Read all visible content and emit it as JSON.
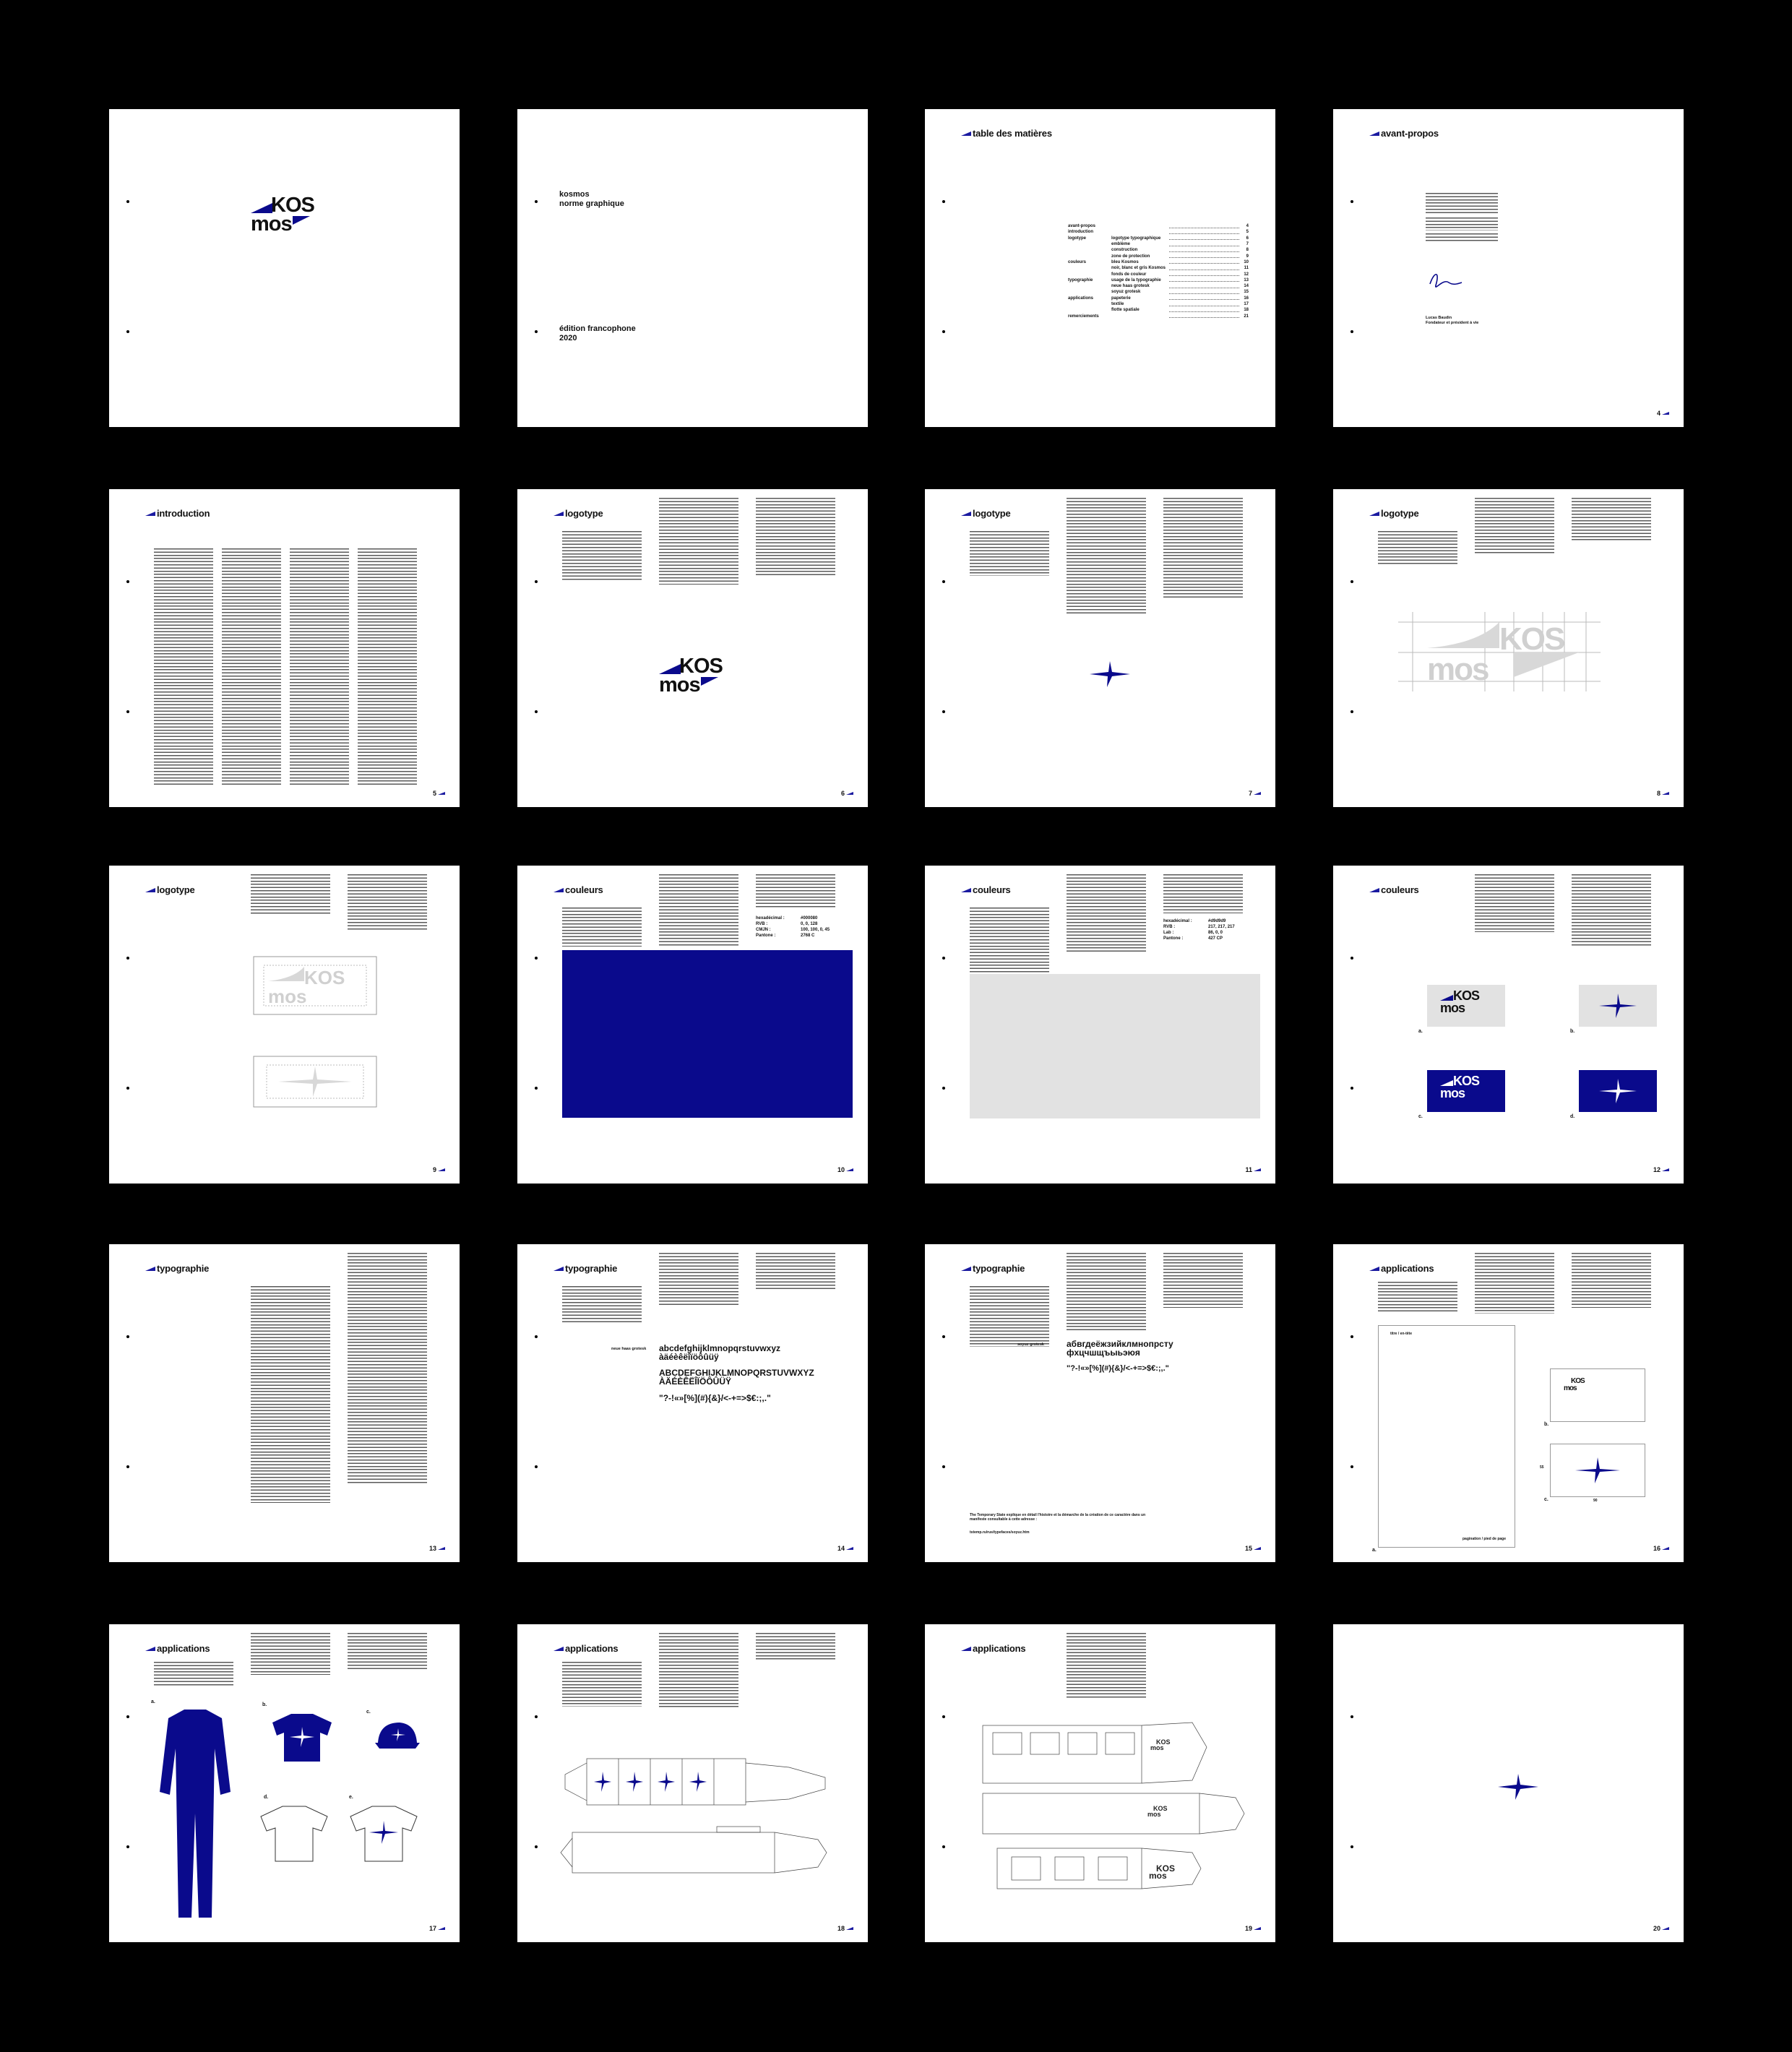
{
  "colors": {
    "brand_blue": "#0a0a8c",
    "accent": "#1a1aa0",
    "light_gray": "#e2e2e2"
  },
  "cover": {
    "logo_top": "KOS",
    "logo_bottom": "mos"
  },
  "title_page": {
    "line1": "kosmos",
    "line2": "norme graphique",
    "edition_line1": "édition francophone",
    "edition_line2": "2020"
  },
  "toc": {
    "title": "table des matières",
    "rows": [
      {
        "section": "avant-propos",
        "item": "",
        "page": "4"
      },
      {
        "section": "introduction",
        "item": "",
        "page": "5"
      },
      {
        "section": "logotype",
        "item": "logotype typographique",
        "page": "6"
      },
      {
        "section": "",
        "item": "emblème",
        "page": "7"
      },
      {
        "section": "",
        "item": "construction",
        "page": "8"
      },
      {
        "section": "",
        "item": "zone de protection",
        "page": "9"
      },
      {
        "section": "couleurs",
        "item": "bleu Kosmos",
        "page": "10"
      },
      {
        "section": "",
        "item": "noir, blanc et gris Kosmos",
        "page": "11"
      },
      {
        "section": "",
        "item": "fonds de couleur",
        "page": "12"
      },
      {
        "section": "typographie",
        "item": "usage de la typographie",
        "page": "13"
      },
      {
        "section": "",
        "item": "neue haas grotesk",
        "page": "14"
      },
      {
        "section": "",
        "item": "soyuz grotesk",
        "page": "15"
      },
      {
        "section": "applications",
        "item": "papeterie",
        "page": "16"
      },
      {
        "section": "",
        "item": "textile",
        "page": "17"
      },
      {
        "section": "",
        "item": "flotte spatiale",
        "page": "18"
      },
      {
        "section": "remerciements",
        "item": "",
        "page": "21"
      }
    ]
  },
  "avant_propos": {
    "title": "avant-propos",
    "sign_name": "Lucas Baudin",
    "sign_role": "Fondateur et président à vie"
  },
  "section_titles": {
    "introduction": "introduction",
    "logotype": "logotype",
    "couleurs": "couleurs",
    "typographie": "typographie",
    "applications": "applications"
  },
  "couleurs_p10": {
    "rows": [
      [
        "hexadécimal :",
        "#000080"
      ],
      [
        "RVB :",
        "0, 0, 128"
      ],
      [
        "CMJN :",
        "100, 100, 0, 45"
      ],
      [
        "Pantone :",
        "2768 C"
      ]
    ]
  },
  "couleurs_p11": {
    "rows": [
      [
        "hexadécimal :",
        "#d9d9d9"
      ],
      [
        "RVB :",
        "217, 217, 217"
      ],
      [
        "Lab :",
        "86, 0, 0"
      ],
      [
        "Pantone :",
        "427 CP"
      ]
    ]
  },
  "couleurs_p12": {
    "labels": [
      "a.",
      "b.",
      "c.",
      "d."
    ]
  },
  "typo_p14": {
    "font": "neue haas grotesk",
    "lower1": "abcdefghijklmnopqrstuvwxyz",
    "lower2": "àäéèêëîïöôûüÿ",
    "upper1": "ABCDEFGHIJKLMNOPQRSTUVWXYZ",
    "upper2": "ÀÄÉÈÊËÎÏÖÔÛÜŸ",
    "symbols": "\"?-!«»[%](#){&}/<-+=>$€:;,.\""
  },
  "typo_p15": {
    "font": "soyuz grotesk",
    "cyr1": "абвгдеёжзийклмнопрсту",
    "cyr2": "фхцчшщъыьэюя",
    "symbols": "\"?-!«»[%](#){&}/<-+=>$€:;,.\"",
    "footnote": "The Temporary State explique en détail l'histoire et la démarche de la création de ce caractère dans un manifeste consultable à cette adresse :",
    "url": "tstemp.ru/rus/typefaces/soyuz.htm"
  },
  "papeterie": {
    "label_a": "a.",
    "label_b": "b.",
    "label_c": "c.",
    "header": "titre / en-tête",
    "footer": "pagination / pied de page",
    "dim_h": "55",
    "dim_w": "90"
  },
  "textile_labels": [
    "a.",
    "b.",
    "c.",
    "d.",
    "e."
  ],
  "page_numbers": [
    "4",
    "5",
    "6",
    "7",
    "8",
    "9",
    "10",
    "11",
    "12",
    "13",
    "14",
    "15",
    "16",
    "17",
    "18",
    "19",
    "20"
  ]
}
